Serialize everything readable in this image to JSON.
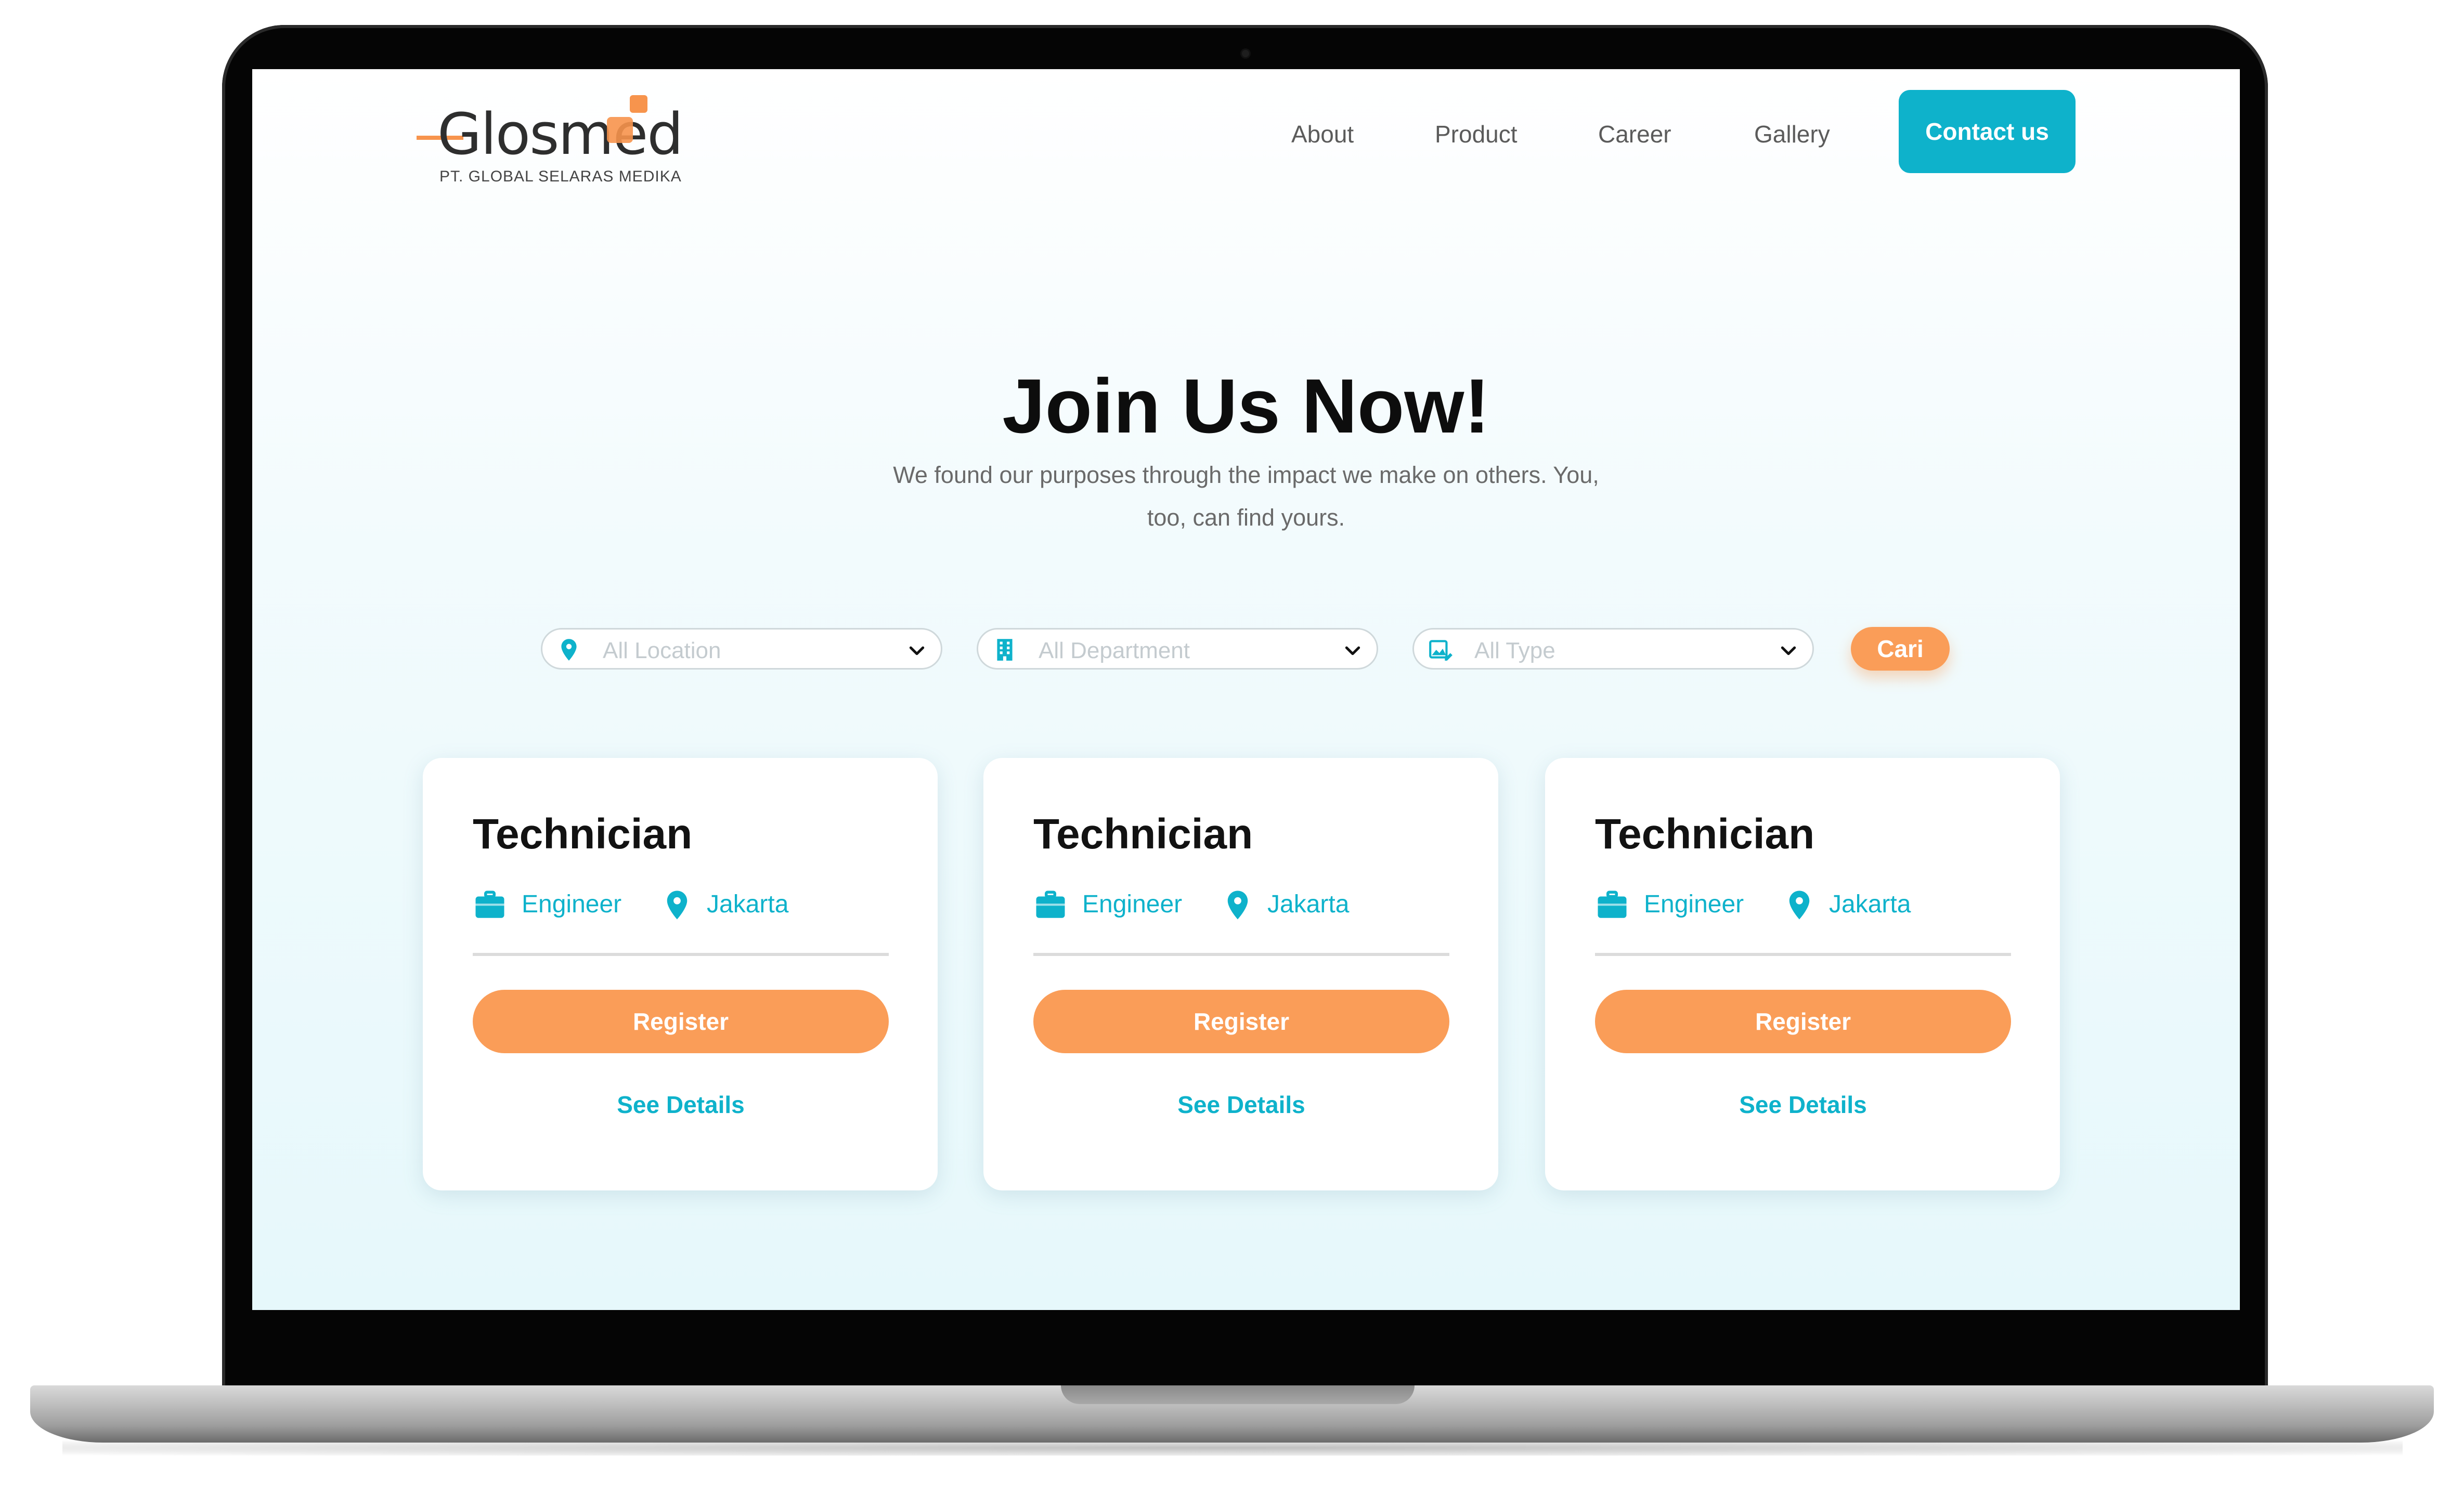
{
  "header": {
    "logo_text": "Glosmed",
    "logo_subtitle": "PT. GLOBAL SELARAS MEDIKA",
    "nav": [
      {
        "label": "About"
      },
      {
        "label": "Product"
      },
      {
        "label": "Career"
      },
      {
        "label": "Gallery"
      }
    ],
    "contact_label": "Contact us"
  },
  "hero": {
    "title": "Join Us Now!",
    "subtitle_line1": "We found our purposes through the impact we make on others. You,",
    "subtitle_line2": "too, can find yours."
  },
  "filters": {
    "location": {
      "placeholder": "All Location",
      "icon": "location-pin-icon"
    },
    "department": {
      "placeholder": "All Department",
      "icon": "building-icon"
    },
    "type": {
      "placeholder": "All Type",
      "icon": "image-edit-icon"
    },
    "search_label": "Cari"
  },
  "jobs": [
    {
      "title": "Technician",
      "category": "Engineer",
      "location": "Jakarta",
      "register_label": "Register",
      "details_label": "See Details"
    },
    {
      "title": "Technician",
      "category": "Engineer",
      "location": "Jakarta",
      "register_label": "Register",
      "details_label": "See Details"
    },
    {
      "title": "Technician",
      "category": "Engineer",
      "location": "Jakarta",
      "register_label": "Register",
      "details_label": "See Details"
    }
  ],
  "colors": {
    "accent": "#0eb2cb",
    "orange": "#fa9d58",
    "logo_orange": "#f7944d"
  }
}
